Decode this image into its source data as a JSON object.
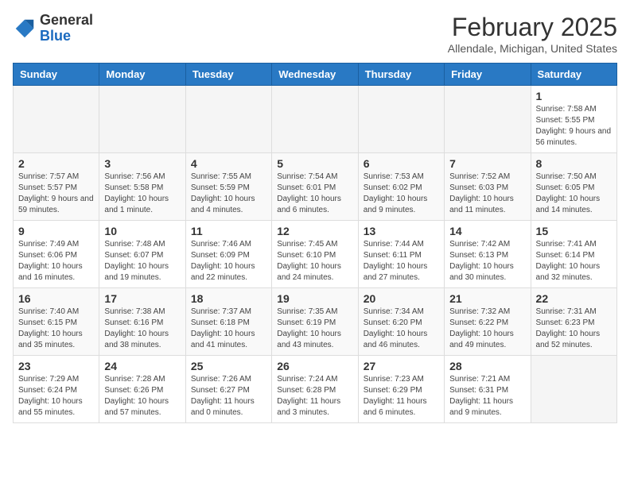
{
  "header": {
    "logo_general": "General",
    "logo_blue": "Blue",
    "month_title": "February 2025",
    "location": "Allendale, Michigan, United States"
  },
  "weekdays": [
    "Sunday",
    "Monday",
    "Tuesday",
    "Wednesday",
    "Thursday",
    "Friday",
    "Saturday"
  ],
  "weeks": [
    [
      {
        "day": "",
        "info": ""
      },
      {
        "day": "",
        "info": ""
      },
      {
        "day": "",
        "info": ""
      },
      {
        "day": "",
        "info": ""
      },
      {
        "day": "",
        "info": ""
      },
      {
        "day": "",
        "info": ""
      },
      {
        "day": "1",
        "info": "Sunrise: 7:58 AM\nSunset: 5:55 PM\nDaylight: 9 hours and 56 minutes."
      }
    ],
    [
      {
        "day": "2",
        "info": "Sunrise: 7:57 AM\nSunset: 5:57 PM\nDaylight: 9 hours and 59 minutes."
      },
      {
        "day": "3",
        "info": "Sunrise: 7:56 AM\nSunset: 5:58 PM\nDaylight: 10 hours and 1 minute."
      },
      {
        "day": "4",
        "info": "Sunrise: 7:55 AM\nSunset: 5:59 PM\nDaylight: 10 hours and 4 minutes."
      },
      {
        "day": "5",
        "info": "Sunrise: 7:54 AM\nSunset: 6:01 PM\nDaylight: 10 hours and 6 minutes."
      },
      {
        "day": "6",
        "info": "Sunrise: 7:53 AM\nSunset: 6:02 PM\nDaylight: 10 hours and 9 minutes."
      },
      {
        "day": "7",
        "info": "Sunrise: 7:52 AM\nSunset: 6:03 PM\nDaylight: 10 hours and 11 minutes."
      },
      {
        "day": "8",
        "info": "Sunrise: 7:50 AM\nSunset: 6:05 PM\nDaylight: 10 hours and 14 minutes."
      }
    ],
    [
      {
        "day": "9",
        "info": "Sunrise: 7:49 AM\nSunset: 6:06 PM\nDaylight: 10 hours and 16 minutes."
      },
      {
        "day": "10",
        "info": "Sunrise: 7:48 AM\nSunset: 6:07 PM\nDaylight: 10 hours and 19 minutes."
      },
      {
        "day": "11",
        "info": "Sunrise: 7:46 AM\nSunset: 6:09 PM\nDaylight: 10 hours and 22 minutes."
      },
      {
        "day": "12",
        "info": "Sunrise: 7:45 AM\nSunset: 6:10 PM\nDaylight: 10 hours and 24 minutes."
      },
      {
        "day": "13",
        "info": "Sunrise: 7:44 AM\nSunset: 6:11 PM\nDaylight: 10 hours and 27 minutes."
      },
      {
        "day": "14",
        "info": "Sunrise: 7:42 AM\nSunset: 6:13 PM\nDaylight: 10 hours and 30 minutes."
      },
      {
        "day": "15",
        "info": "Sunrise: 7:41 AM\nSunset: 6:14 PM\nDaylight: 10 hours and 32 minutes."
      }
    ],
    [
      {
        "day": "16",
        "info": "Sunrise: 7:40 AM\nSunset: 6:15 PM\nDaylight: 10 hours and 35 minutes."
      },
      {
        "day": "17",
        "info": "Sunrise: 7:38 AM\nSunset: 6:16 PM\nDaylight: 10 hours and 38 minutes."
      },
      {
        "day": "18",
        "info": "Sunrise: 7:37 AM\nSunset: 6:18 PM\nDaylight: 10 hours and 41 minutes."
      },
      {
        "day": "19",
        "info": "Sunrise: 7:35 AM\nSunset: 6:19 PM\nDaylight: 10 hours and 43 minutes."
      },
      {
        "day": "20",
        "info": "Sunrise: 7:34 AM\nSunset: 6:20 PM\nDaylight: 10 hours and 46 minutes."
      },
      {
        "day": "21",
        "info": "Sunrise: 7:32 AM\nSunset: 6:22 PM\nDaylight: 10 hours and 49 minutes."
      },
      {
        "day": "22",
        "info": "Sunrise: 7:31 AM\nSunset: 6:23 PM\nDaylight: 10 hours and 52 minutes."
      }
    ],
    [
      {
        "day": "23",
        "info": "Sunrise: 7:29 AM\nSunset: 6:24 PM\nDaylight: 10 hours and 55 minutes."
      },
      {
        "day": "24",
        "info": "Sunrise: 7:28 AM\nSunset: 6:26 PM\nDaylight: 10 hours and 57 minutes."
      },
      {
        "day": "25",
        "info": "Sunrise: 7:26 AM\nSunset: 6:27 PM\nDaylight: 11 hours and 0 minutes."
      },
      {
        "day": "26",
        "info": "Sunrise: 7:24 AM\nSunset: 6:28 PM\nDaylight: 11 hours and 3 minutes."
      },
      {
        "day": "27",
        "info": "Sunrise: 7:23 AM\nSunset: 6:29 PM\nDaylight: 11 hours and 6 minutes."
      },
      {
        "day": "28",
        "info": "Sunrise: 7:21 AM\nSunset: 6:31 PM\nDaylight: 11 hours and 9 minutes."
      },
      {
        "day": "",
        "info": ""
      }
    ]
  ]
}
